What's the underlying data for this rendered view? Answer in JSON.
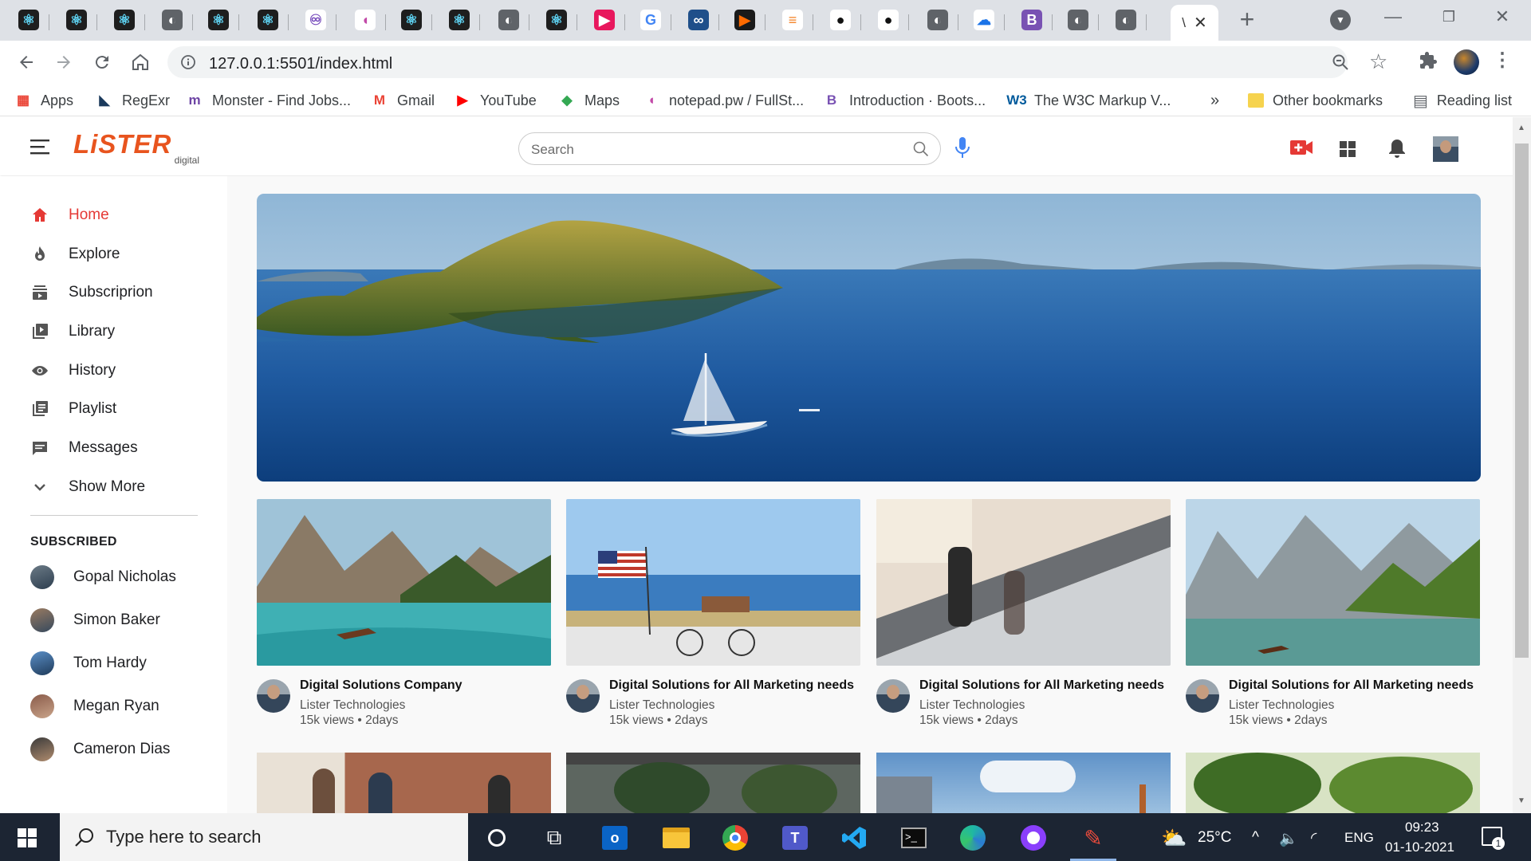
{
  "browser": {
    "tabs": [
      {
        "icon": "react-icon",
        "glyph": "⚛",
        "bg": "#1e1e1e",
        "fg": "#61dafb"
      },
      {
        "icon": "react-icon",
        "glyph": "⚛",
        "bg": "#1e1e1e",
        "fg": "#61dafb"
      },
      {
        "icon": "react-icon",
        "glyph": "⚛",
        "bg": "#1e1e1e",
        "fg": "#61dafb"
      },
      {
        "icon": "globe-icon",
        "glyph": "◐",
        "bg": "#5f6368",
        "fg": "#ffffff"
      },
      {
        "icon": "react-icon",
        "glyph": "⚛",
        "bg": "#1e1e1e",
        "fg": "#61dafb"
      },
      {
        "icon": "react-icon",
        "glyph": "⚛",
        "bg": "#1e1e1e",
        "fg": "#61dafb"
      },
      {
        "icon": "redux-icon",
        "glyph": "♾",
        "bg": "#ffffff",
        "fg": "#764abc"
      },
      {
        "icon": "notepad-icon",
        "glyph": "◖",
        "bg": "#ffffff",
        "fg": "#c249a8"
      },
      {
        "icon": "react-icon",
        "glyph": "⚛",
        "bg": "#1e1e1e",
        "fg": "#61dafb"
      },
      {
        "icon": "react-icon",
        "glyph": "⚛",
        "bg": "#1e1e1e",
        "fg": "#61dafb"
      },
      {
        "icon": "globe-icon",
        "glyph": "◐",
        "bg": "#5f6368",
        "fg": "#ffffff"
      },
      {
        "icon": "react-icon",
        "glyph": "⚛",
        "bg": "#1e1e1e",
        "fg": "#61dafb"
      },
      {
        "icon": "play-icon",
        "glyph": "▶",
        "bg": "#e8175d",
        "fg": "#ffffff"
      },
      {
        "icon": "google-icon",
        "glyph": "G",
        "bg": "#ffffff",
        "fg": "#4285f4"
      },
      {
        "icon": "infinity-icon",
        "glyph": "∞",
        "bg": "#1f4f8a",
        "fg": "#ffffff"
      },
      {
        "icon": "arrow-icon",
        "glyph": "▶",
        "bg": "#1a1a1a",
        "fg": "#ff6a00"
      },
      {
        "icon": "stackoverflow-icon",
        "glyph": "≡",
        "bg": "#ffffff",
        "fg": "#f48024"
      },
      {
        "icon": "github-icon",
        "glyph": "●",
        "bg": "#ffffff",
        "fg": "#111111"
      },
      {
        "icon": "github-icon",
        "glyph": "●",
        "bg": "#ffffff",
        "fg": "#111111"
      },
      {
        "icon": "globe-icon",
        "glyph": "◐",
        "bg": "#5f6368",
        "fg": "#ffffff"
      },
      {
        "icon": "cloud-icon",
        "glyph": "☁",
        "bg": "#ffffff",
        "fg": "#1a73e8"
      },
      {
        "icon": "bootstrap-icon",
        "glyph": "B",
        "bg": "#7952b3",
        "fg": "#ffffff"
      },
      {
        "icon": "globe-icon",
        "glyph": "◐",
        "bg": "#5f6368",
        "fg": "#ffffff"
      },
      {
        "icon": "globe-icon",
        "glyph": "◐",
        "bg": "#5f6368",
        "fg": "#ffffff"
      }
    ],
    "active_tab_label": "\\",
    "url": "127.0.0.1:5501/index.html",
    "bookmarks": [
      {
        "label": "Apps",
        "icon": "apps-grid-icon",
        "glyph": "▦",
        "color": "#ea4335"
      },
      {
        "label": "RegExr",
        "icon": "regexr-icon",
        "glyph": "◣",
        "color": "#1b3a5c"
      },
      {
        "label": "Monster - Find Jobs...",
        "icon": "monster-icon",
        "glyph": "m",
        "color": "#6e45a5"
      },
      {
        "label": "Gmail",
        "icon": "gmail-icon",
        "glyph": "M",
        "color": "#ea4335"
      },
      {
        "label": "YouTube",
        "icon": "youtube-icon",
        "glyph": "▶",
        "color": "#ff0000"
      },
      {
        "label": "Maps",
        "icon": "maps-icon",
        "glyph": "◆",
        "color": "#34a853"
      },
      {
        "label": "notepad.pw / FullSt...",
        "icon": "notepad-icon",
        "glyph": "◖",
        "color": "#c249a8"
      },
      {
        "label": "Introduction · Boots...",
        "icon": "bootstrap-icon",
        "glyph": "B",
        "color": "#7952b3"
      },
      {
        "label": "The W3C Markup V...",
        "icon": "w3c-icon",
        "glyph": "W3",
        "color": "#005a9c"
      }
    ],
    "more_bookmarks": "»",
    "other_bookmarks": "Other bookmarks",
    "reading_list": "Reading list"
  },
  "app": {
    "logo_text": "LiSTER",
    "logo_sub": "digital",
    "search_placeholder": "Search",
    "brand_color": "#e53935",
    "nav": [
      {
        "label": "Home",
        "icon": "home-icon",
        "active": true
      },
      {
        "label": "Explore",
        "icon": "fire-icon"
      },
      {
        "label": "Subscriprion",
        "icon": "subscriptions-icon"
      },
      {
        "label": "Library",
        "icon": "library-icon"
      },
      {
        "label": "History",
        "icon": "history-eye-icon"
      },
      {
        "label": "Playlist",
        "icon": "playlist-icon"
      },
      {
        "label": "Messages",
        "icon": "messages-icon"
      },
      {
        "label": "Show More",
        "icon": "chevron-down-icon"
      }
    ],
    "subscribed_heading": "SUBSCRIBED",
    "subscribed": [
      "Gopal Nicholas",
      "Simon Baker",
      "Tom Hardy",
      "Megan Ryan",
      "Cameron Dias"
    ],
    "videos": [
      {
        "title": "Digital Solutions Company",
        "channel": "Lister Technologies",
        "meta": "15k views • 2days"
      },
      {
        "title": "Digital Solutions for All Marketing needs",
        "channel": "Lister Technologies",
        "meta": "15k views • 2days"
      },
      {
        "title": "Digital Solutions for All Marketing needs",
        "channel": "Lister Technologies",
        "meta": "15k views • 2days"
      },
      {
        "title": "Digital Solutions for All Marketing needs",
        "channel": "Lister Technologies",
        "meta": "15k views • 2days"
      }
    ]
  },
  "taskbar": {
    "search_placeholder": "Type here to search",
    "temperature": "25°C",
    "language": "ENG",
    "time": "09:23",
    "date": "01-10-2021",
    "notification_count": "1"
  }
}
